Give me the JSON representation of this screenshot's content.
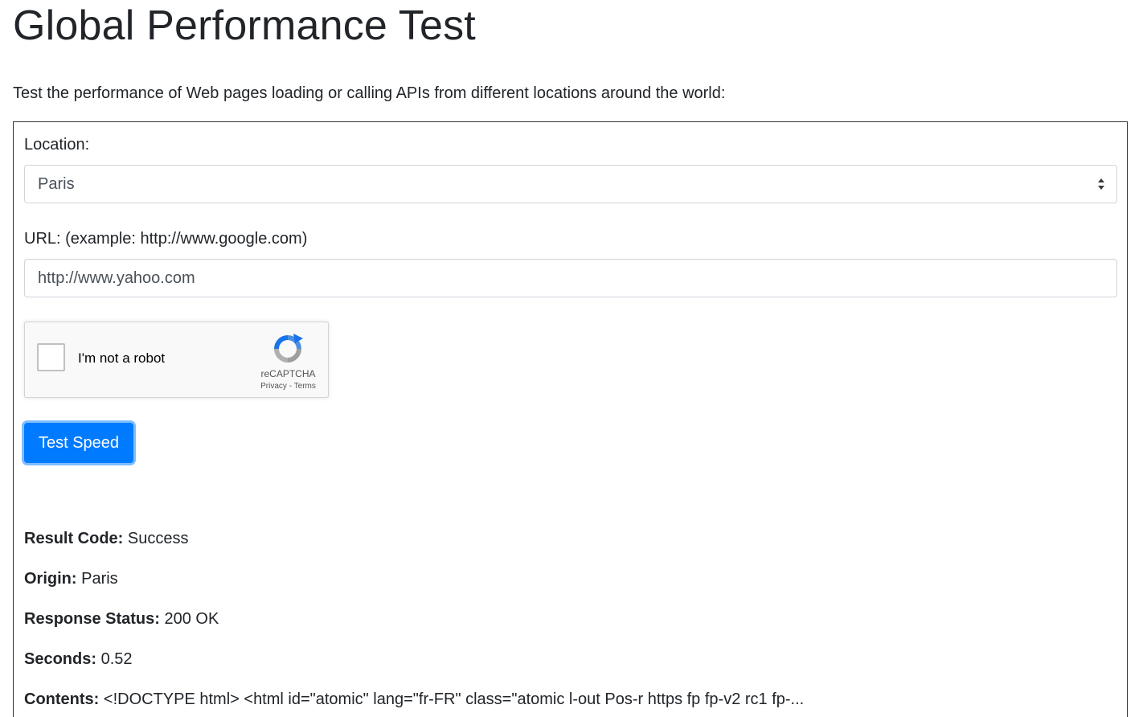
{
  "page": {
    "title": "Global Performance Test",
    "intro": "Test the performance of Web pages loading or calling APIs from different locations around the world:"
  },
  "form": {
    "location_label": "Location:",
    "location_value": "Paris",
    "url_label": "URL: (example: http://www.google.com)",
    "url_value": "http://www.yahoo.com",
    "captcha": {
      "label": "I'm not a robot",
      "brand": "reCAPTCHA",
      "privacy": "Privacy",
      "separator": " - ",
      "terms": "Terms"
    },
    "submit_label": "Test Speed"
  },
  "results": {
    "result_code_label": "Result Code:",
    "result_code_value": "Success",
    "origin_label": "Origin:",
    "origin_value": "Paris",
    "response_status_label": "Response Status:",
    "response_status_value": "200 OK",
    "seconds_label": "Seconds:",
    "seconds_value": "0.52",
    "contents_label": "Contents:",
    "contents_value": "<!DOCTYPE html> <html id=\"atomic\" lang=\"fr-FR\" class=\"atomic l-out Pos-r https fp fp-v2 rc1 fp-..."
  },
  "colors": {
    "primary": "#007bff",
    "text": "#212529",
    "border": "#ced4da"
  }
}
